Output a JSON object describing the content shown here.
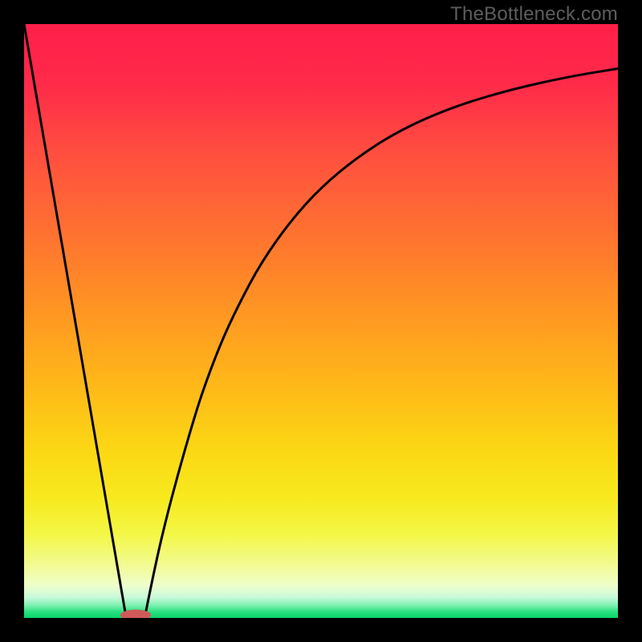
{
  "attribution": "TheBottleneck.com",
  "chart_data": {
    "type": "line",
    "title": "",
    "xlabel": "",
    "ylabel": "",
    "xlim": [
      0,
      100
    ],
    "ylim": [
      0,
      100
    ],
    "grid": false,
    "legend": false,
    "gradient_stops": [
      {
        "offset": 0.0,
        "color": "#ff1f4a"
      },
      {
        "offset": 0.1,
        "color": "#ff2a49"
      },
      {
        "offset": 0.22,
        "color": "#ff4f3f"
      },
      {
        "offset": 0.35,
        "color": "#ff7131"
      },
      {
        "offset": 0.48,
        "color": "#ff9523"
      },
      {
        "offset": 0.6,
        "color": "#ffb619"
      },
      {
        "offset": 0.72,
        "color": "#fbd814"
      },
      {
        "offset": 0.8,
        "color": "#f7ea1f"
      },
      {
        "offset": 0.86,
        "color": "#f4f748"
      },
      {
        "offset": 0.91,
        "color": "#f2fb91"
      },
      {
        "offset": 0.945,
        "color": "#effecb"
      },
      {
        "offset": 0.965,
        "color": "#c9fadb"
      },
      {
        "offset": 0.978,
        "color": "#82f1b4"
      },
      {
        "offset": 0.99,
        "color": "#27e07e"
      },
      {
        "offset": 1.0,
        "color": "#09d56a"
      }
    ],
    "series": [
      {
        "name": "left-arm",
        "type": "line",
        "x": [
          0.0,
          17.2
        ],
        "y": [
          100.0,
          0.0
        ]
      },
      {
        "name": "right-arm",
        "type": "line",
        "x": [
          20.3,
          22,
          24,
          26,
          28,
          30,
          33,
          36,
          40,
          45,
          50,
          56,
          63,
          72,
          82,
          92,
          100
        ],
        "y": [
          0.0,
          8.5,
          17.0,
          24.5,
          31.5,
          38.0,
          46.0,
          52.5,
          60.0,
          67.0,
          72.5,
          77.5,
          82.0,
          86.0,
          89.0,
          91.2,
          92.5
        ]
      }
    ],
    "marker": {
      "name": "minimum-marker",
      "cx": 18.8,
      "cy": 0.5,
      "rx": 2.6,
      "ry": 0.9,
      "color": "#d05a59"
    }
  }
}
